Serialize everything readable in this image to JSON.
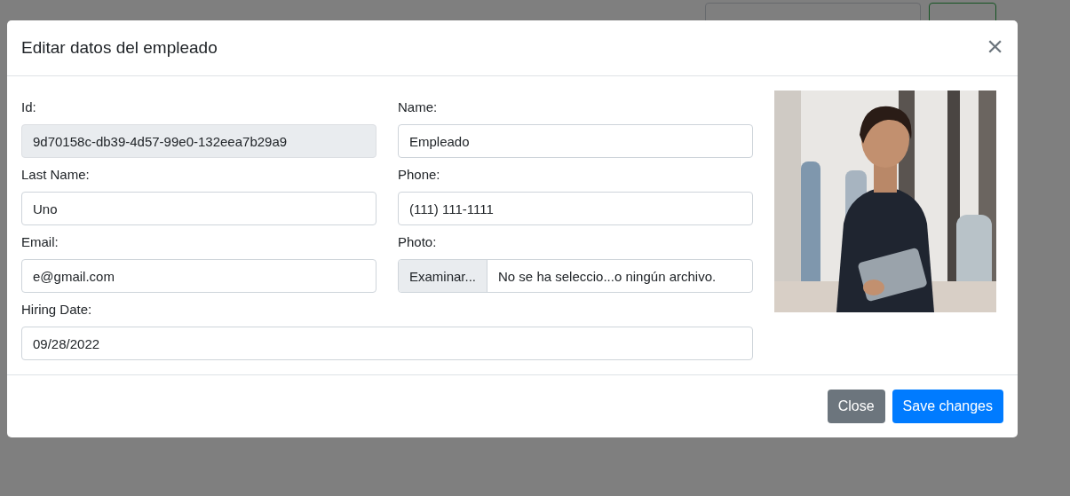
{
  "modal": {
    "title": "Editar datos del empleado",
    "close": "×",
    "fields": [
      {
        "label": "Id:",
        "value": "9d70158c-db39-4d57-99e0-132eea7b29a9",
        "kind": "text",
        "disabled": true
      },
      {
        "label": "Name:",
        "value": "Empleado",
        "kind": "text",
        "disabled": false
      },
      {
        "label": "Last Name:",
        "value": "Uno",
        "kind": "text",
        "disabled": false
      },
      {
        "label": "Phone:",
        "value": "(111) 111-1111",
        "kind": "text",
        "disabled": false
      },
      {
        "label": "Email:",
        "value": "e@gmail.com",
        "kind": "text",
        "disabled": false
      },
      {
        "label": "Photo:",
        "browse": "Examinar...",
        "value": "No se ha seleccio...o ningún archivo.",
        "kind": "file",
        "disabled": false
      },
      {
        "label": "Hiring Date:",
        "value": "09/28/2022",
        "kind": "wide",
        "disabled": false
      }
    ],
    "buttons": [
      {
        "label": "Close",
        "kind": "secondary"
      },
      {
        "label": "Save changes",
        "kind": "primary"
      }
    ]
  }
}
